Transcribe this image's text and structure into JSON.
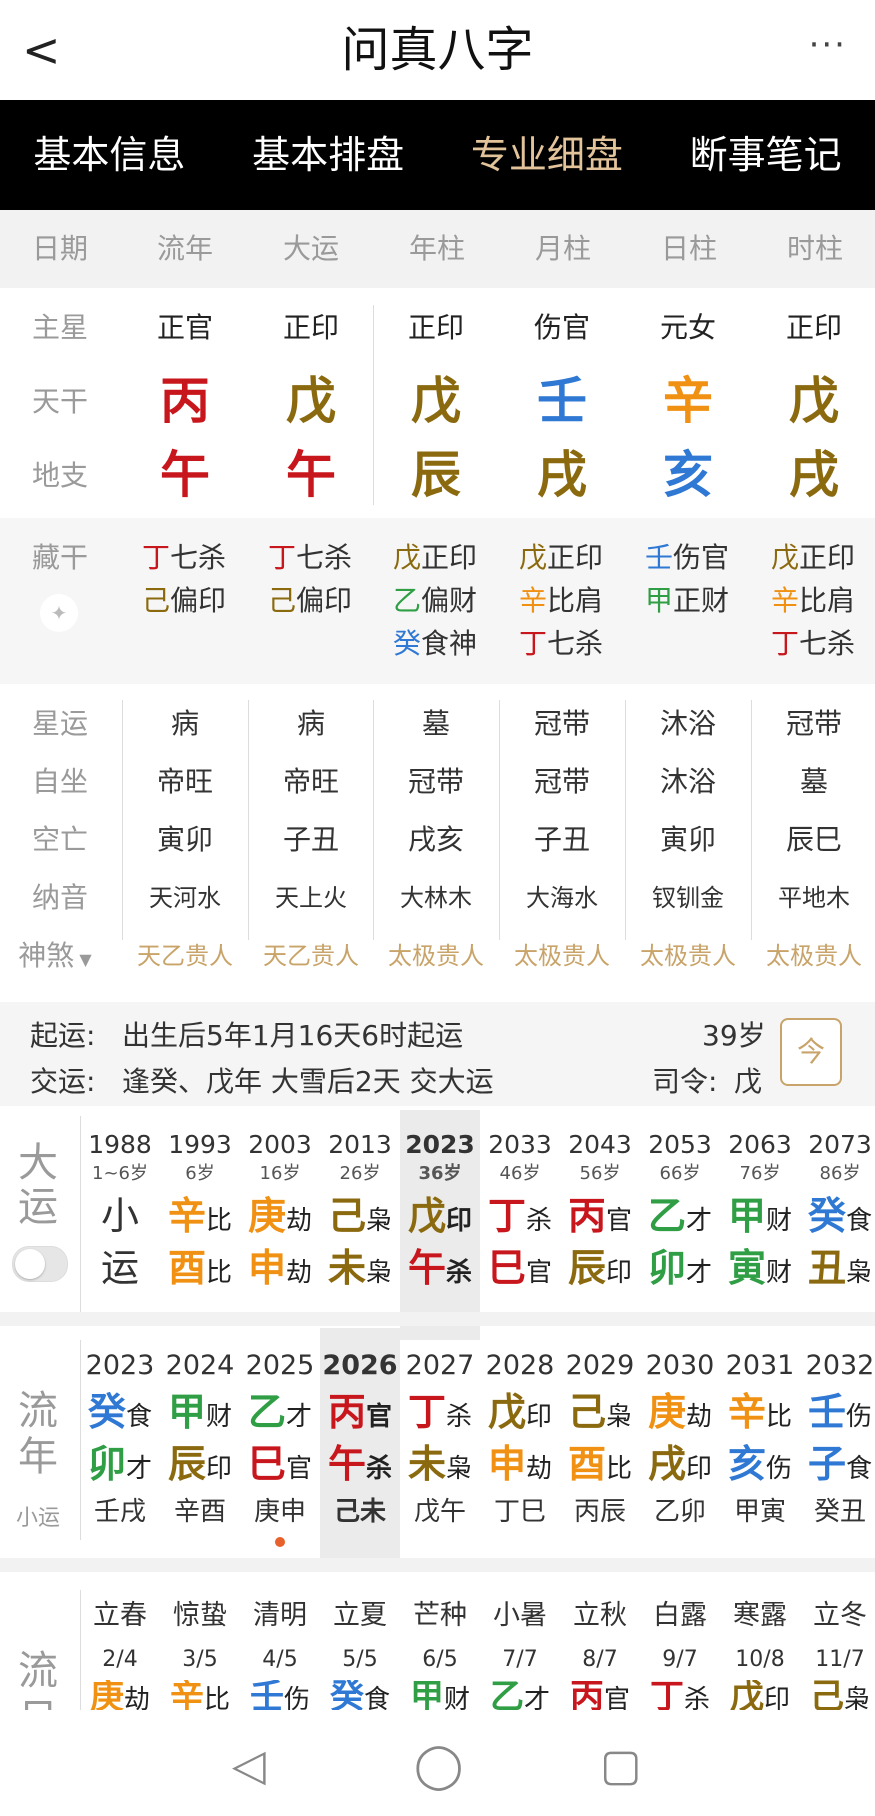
{
  "header": {
    "back": "<",
    "title": "问真八字",
    "more": "···"
  },
  "tabs": [
    "基本信息",
    "基本排盘",
    "专业细盘",
    "断事笔记"
  ],
  "columns": [
    "日期",
    "流年",
    "大运",
    "年柱",
    "月柱",
    "日柱",
    "时柱"
  ],
  "rows": {
    "zhuxing": {
      "label": "主星",
      "values": [
        "正官",
        "正印",
        "正印",
        "伤官",
        "元女",
        "正印"
      ]
    },
    "tiangan": {
      "label": "天干",
      "values": [
        "丙",
        "戊",
        "戊",
        "壬",
        "辛",
        "戊"
      ]
    },
    "dizhi": {
      "label": "地支",
      "values": [
        "午",
        "午",
        "辰",
        "戌",
        "亥",
        "戌"
      ]
    }
  },
  "canggan": {
    "label": "藏干",
    "cols": [
      [
        [
          "丁",
          "七杀"
        ],
        [
          "己",
          "偏印"
        ]
      ],
      [
        [
          "丁",
          "七杀"
        ],
        [
          "己",
          "偏印"
        ]
      ],
      [
        [
          "戊",
          "正印"
        ],
        [
          "乙",
          "偏财"
        ],
        [
          "癸",
          "食神"
        ]
      ],
      [
        [
          "戊",
          "正印"
        ],
        [
          "辛",
          "比肩"
        ],
        [
          "丁",
          "七杀"
        ]
      ],
      [
        [
          "壬",
          "伤官"
        ],
        [
          "甲",
          "正财"
        ]
      ],
      [
        [
          "戊",
          "正印"
        ],
        [
          "辛",
          "比肩"
        ],
        [
          "丁",
          "七杀"
        ]
      ]
    ]
  },
  "info": {
    "xingyun": {
      "label": "星运",
      "values": [
        "病",
        "病",
        "墓",
        "冠带",
        "沐浴",
        "冠带"
      ]
    },
    "zizuo": {
      "label": "自坐",
      "values": [
        "帝旺",
        "帝旺",
        "冠带",
        "冠带",
        "沐浴",
        "墓"
      ]
    },
    "kongwang": {
      "label": "空亡",
      "values": [
        "寅卯",
        "子丑",
        "戌亥",
        "子丑",
        "寅卯",
        "辰巳"
      ]
    },
    "nayin": {
      "label": "纳音",
      "values": [
        "天河水",
        "天上火",
        "大林木",
        "大海水",
        "钗钏金",
        "平地木"
      ]
    },
    "shensha": {
      "label": "神煞",
      "values": [
        "天乙贵人",
        "天乙贵人",
        "太极贵人",
        "太极贵人",
        "太极贵人",
        "太极贵人"
      ]
    }
  },
  "qiyun": {
    "line1_label": "起运:",
    "line1_text": "出生后5年1月16天6时起运",
    "line2_label": "交运:",
    "line2_text": "逢癸、戊年 大雪后2天 交大运",
    "age": "39岁",
    "siling_label": "司令:",
    "siling_value": "戊",
    "cal_icon": "今"
  },
  "dayun": {
    "label1": "大",
    "label2": "运",
    "cols": [
      {
        "year": "1988",
        "age": "1~6岁",
        "g": "小",
        "gs": "",
        "z": "运",
        "zs": ""
      },
      {
        "year": "1993",
        "age": "6岁",
        "g": "辛",
        "gs": "比",
        "z": "酉",
        "zs": "比"
      },
      {
        "year": "2003",
        "age": "16岁",
        "g": "庚",
        "gs": "劫",
        "z": "申",
        "zs": "劫"
      },
      {
        "year": "2013",
        "age": "26岁",
        "g": "己",
        "gs": "枭",
        "z": "未",
        "zs": "枭"
      },
      {
        "year": "2023",
        "age": "36岁",
        "g": "戊",
        "gs": "印",
        "z": "午",
        "zs": "杀"
      },
      {
        "year": "2033",
        "age": "46岁",
        "g": "丁",
        "gs": "杀",
        "z": "巳",
        "zs": "官"
      },
      {
        "year": "2043",
        "age": "56岁",
        "g": "丙",
        "gs": "官",
        "z": "辰",
        "zs": "印"
      },
      {
        "year": "2053",
        "age": "66岁",
        "g": "乙",
        "gs": "才",
        "z": "卯",
        "zs": "才"
      },
      {
        "year": "2063",
        "age": "76岁",
        "g": "甲",
        "gs": "财",
        "z": "寅",
        "zs": "财"
      },
      {
        "year": "2073",
        "age": "86岁",
        "g": "癸",
        "gs": "食",
        "z": "丑",
        "zs": "枭"
      }
    ]
  },
  "liunian": {
    "label1": "流",
    "label2": "年",
    "label3": "小运",
    "cols": [
      {
        "year": "2023",
        "g": "癸",
        "gs": "食",
        "z": "卯",
        "zs": "才",
        "xy": "壬戌"
      },
      {
        "year": "2024",
        "g": "甲",
        "gs": "财",
        "z": "辰",
        "zs": "印",
        "xy": "辛酉"
      },
      {
        "year": "2025",
        "g": "乙",
        "gs": "才",
        "z": "巳",
        "zs": "官",
        "xy": "庚申"
      },
      {
        "year": "2026",
        "g": "丙",
        "gs": "官",
        "z": "午",
        "zs": "杀",
        "xy": "己未"
      },
      {
        "year": "2027",
        "g": "丁",
        "gs": "杀",
        "z": "未",
        "zs": "枭",
        "xy": "戊午"
      },
      {
        "year": "2028",
        "g": "戊",
        "gs": "印",
        "z": "申",
        "zs": "劫",
        "xy": "丁巳"
      },
      {
        "year": "2029",
        "g": "己",
        "gs": "枭",
        "z": "酉",
        "zs": "比",
        "xy": "丙辰"
      },
      {
        "year": "2030",
        "g": "庚",
        "gs": "劫",
        "z": "戌",
        "zs": "印",
        "xy": "乙卯"
      },
      {
        "year": "2031",
        "g": "辛",
        "gs": "比",
        "z": "亥",
        "zs": "伤",
        "xy": "甲寅"
      },
      {
        "year": "2032",
        "g": "壬",
        "gs": "伤",
        "z": "子",
        "zs": "食",
        "xy": "癸丑"
      }
    ]
  },
  "liuri": {
    "label1": "流",
    "label2": "日",
    "cols": [
      {
        "term": "立春",
        "date": "2/4",
        "g": "庚",
        "gs": "劫"
      },
      {
        "term": "惊蛰",
        "date": "3/5",
        "g": "辛",
        "gs": "比"
      },
      {
        "term": "清明",
        "date": "4/5",
        "g": "壬",
        "gs": "伤"
      },
      {
        "term": "立夏",
        "date": "5/5",
        "g": "癸",
        "gs": "食"
      },
      {
        "term": "芒种",
        "date": "6/5",
        "g": "甲",
        "gs": "财"
      },
      {
        "term": "小暑",
        "date": "7/7",
        "g": "乙",
        "gs": "才"
      },
      {
        "term": "立秋",
        "date": "8/7",
        "g": "丙",
        "gs": "官"
      },
      {
        "term": "白露",
        "date": "9/7",
        "g": "丁",
        "gs": "杀"
      },
      {
        "term": "寒露",
        "date": "10/8",
        "g": "戊",
        "gs": "印"
      },
      {
        "term": "立冬",
        "date": "11/7",
        "g": "己",
        "gs": "枭"
      }
    ]
  },
  "nav": {
    "back": "◁",
    "home": "◯",
    "recent": "▢"
  },
  "colors": {
    "丙": "#c8161d",
    "丁": "#c8161d",
    "午": "#c8161d",
    "巳": "#c8161d",
    "戊": "#8b6a0f",
    "己": "#8b6a0f",
    "辰": "#8b6a0f",
    "戌": "#8b6a0f",
    "未": "#8b6a0f",
    "丑": "#8b6a0f",
    "壬": "#2f78d4",
    "癸": "#2f78d4",
    "亥": "#2f78d4",
    "子": "#2f78d4",
    "辛": "#f09113",
    "庚": "#f09113",
    "申": "#f09113",
    "酉": "#f09113",
    "甲": "#2f9e44",
    "乙": "#2f9e44",
    "寅": "#2f9e44",
    "卯": "#2f9e44",
    "小": "#333333",
    "运": "#333333"
  }
}
